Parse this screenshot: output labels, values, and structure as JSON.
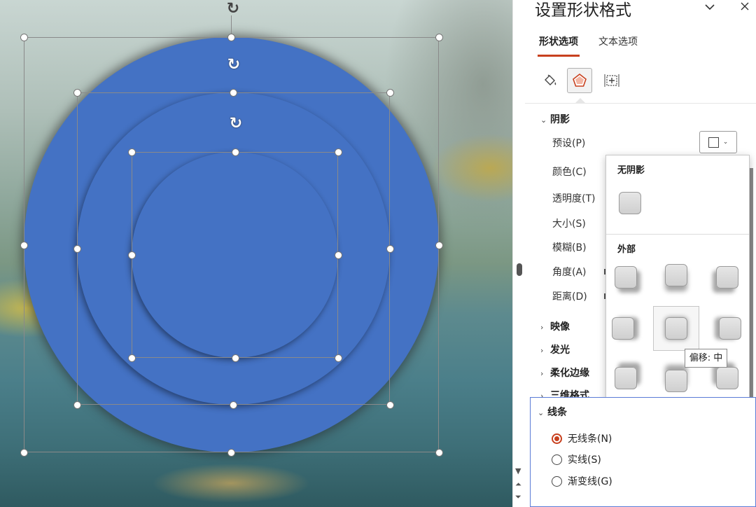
{
  "pane": {
    "title": "设置形状格式",
    "collapse_glyph": "⌄",
    "close_glyph": "✕",
    "tabs": {
      "shape": "形状选项",
      "text": "文本选项"
    },
    "category_icons": [
      "fill-bucket-icon",
      "pentagon-effects-icon",
      "size-layout-icon"
    ],
    "selected_category": "pentagon-effects-icon"
  },
  "shadow": {
    "title": "阴影",
    "expanded": true,
    "preset": "预设(P)",
    "color": "颜色(C)",
    "transparency": "透明度(T)",
    "size": "大小(S)",
    "blur": "模糊(B)",
    "angle": "角度(A)",
    "distance": "距离(D)"
  },
  "collapsed_sections": [
    "映像",
    "发光",
    "柔化边缘",
    "三维格式"
  ],
  "gallery": {
    "no_shadow": "无阴影",
    "outer": "外部",
    "selected_index": 4,
    "tooltip": "偏移: 中"
  },
  "line": {
    "title": "线条",
    "options": [
      {
        "label": "无线条(N)",
        "selected": true
      },
      {
        "label": "实线(S)",
        "selected": false
      },
      {
        "label": "渐变线(G)",
        "selected": false
      }
    ]
  },
  "colors": {
    "shape_fill": "#4472c4",
    "accent": "#c8401e",
    "section_border": "#5a7bd6"
  },
  "canvas": {
    "shapes": [
      "outer-circle",
      "middle-circle",
      "inner-circle"
    ],
    "rotate_glyph": "↻"
  }
}
